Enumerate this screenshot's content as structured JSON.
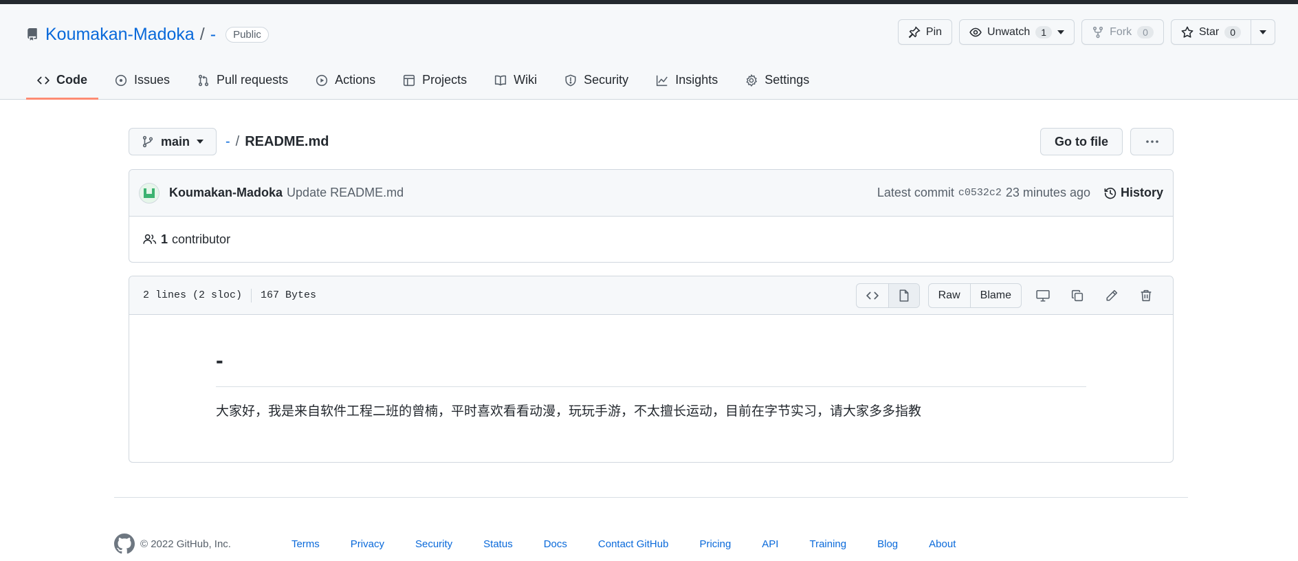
{
  "repo": {
    "owner": "Koumakan-Madoka",
    "separator": "/",
    "name": "-",
    "visibility": "Public"
  },
  "actions": {
    "pin": "Pin",
    "unwatch": "Unwatch",
    "watch_count": "1",
    "fork": "Fork",
    "fork_count": "0",
    "star": "Star",
    "star_count": "0"
  },
  "tabs": [
    {
      "label": "Code",
      "icon": "code-icon"
    },
    {
      "label": "Issues",
      "icon": "issue-opened-icon"
    },
    {
      "label": "Pull requests",
      "icon": "git-pull-request-icon"
    },
    {
      "label": "Actions",
      "icon": "play-icon"
    },
    {
      "label": "Projects",
      "icon": "table-icon"
    },
    {
      "label": "Wiki",
      "icon": "book-icon"
    },
    {
      "label": "Security",
      "icon": "shield-icon"
    },
    {
      "label": "Insights",
      "icon": "graph-icon"
    },
    {
      "label": "Settings",
      "icon": "gear-icon"
    }
  ],
  "filebar": {
    "branch": "main",
    "crumb_root": "-",
    "crumb_sep": "/",
    "file_name": "README.md",
    "goto_file": "Go to file"
  },
  "commit": {
    "author": "Koumakan-Madoka",
    "message": "Update README.md",
    "latest_label": "Latest commit",
    "sha": "c0532c2",
    "time": "23 minutes ago",
    "history": "History",
    "contributors_count": "1",
    "contributors_label": "contributor"
  },
  "file": {
    "lines": "2 lines (2 sloc)",
    "size": "167 Bytes",
    "raw": "Raw",
    "blame": "Blame"
  },
  "readme": {
    "heading": "-",
    "body": "大家好，我是来自软件工程二班的曾楠，平时喜欢看看动漫，玩玩手游，不太擅长运动，目前在字节实习，请大家多多指教"
  },
  "footer": {
    "copyright": "© 2022 GitHub, Inc.",
    "links": [
      "Terms",
      "Privacy",
      "Security",
      "Status",
      "Docs",
      "Contact GitHub",
      "Pricing",
      "API",
      "Training",
      "Blog",
      "About"
    ]
  },
  "colors": {
    "link": "#0969da",
    "tab_underline": "#fd8c73",
    "header_bg": "#f6f8fa",
    "border": "#d0d7de"
  }
}
